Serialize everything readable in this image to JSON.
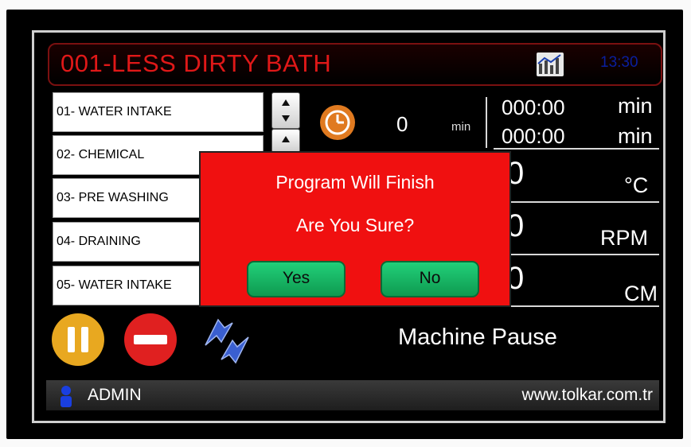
{
  "title": "001-LESS DIRTY BATH",
  "clock": "13:30",
  "steps": [
    {
      "label": "01- WATER INTAKE"
    },
    {
      "label": "02- CHEMICAL"
    },
    {
      "label": "03- PRE WASHING"
    },
    {
      "label": "04- DRAINING"
    },
    {
      "label": "05- WATER INTAKE"
    }
  ],
  "timer": {
    "value": "0",
    "unit": "min"
  },
  "times": [
    {
      "value": "000:00",
      "unit": "min"
    },
    {
      "value": "000:00",
      "unit": "min"
    }
  ],
  "readings": [
    {
      "value": "0",
      "unit": "°C"
    },
    {
      "value": "0",
      "unit": "RPM"
    },
    {
      "value": "0",
      "unit": "CM"
    }
  ],
  "status": "Machine Pause",
  "footer": {
    "user": "ADMIN",
    "url": "www.tolkar.com.tr"
  },
  "dialog": {
    "line1": "Program Will Finish",
    "line2": "Are You Sure?",
    "yes_label": "Yes",
    "no_label": "No"
  },
  "icons": {
    "pause": "pause-icon",
    "stop": "stop-icon",
    "refresh": "refresh-icon",
    "chart": "chart-icon",
    "timer": "timer-icon",
    "user": "user-icon"
  },
  "colors": {
    "title": "#e01818",
    "dialog_bg": "#f01010",
    "dialog_button": "#14b866",
    "pause_button": "#e8a820",
    "stop_button": "#e02020",
    "refresh_arrows": "#3a5fd0",
    "clock": "#0a1fa0"
  }
}
